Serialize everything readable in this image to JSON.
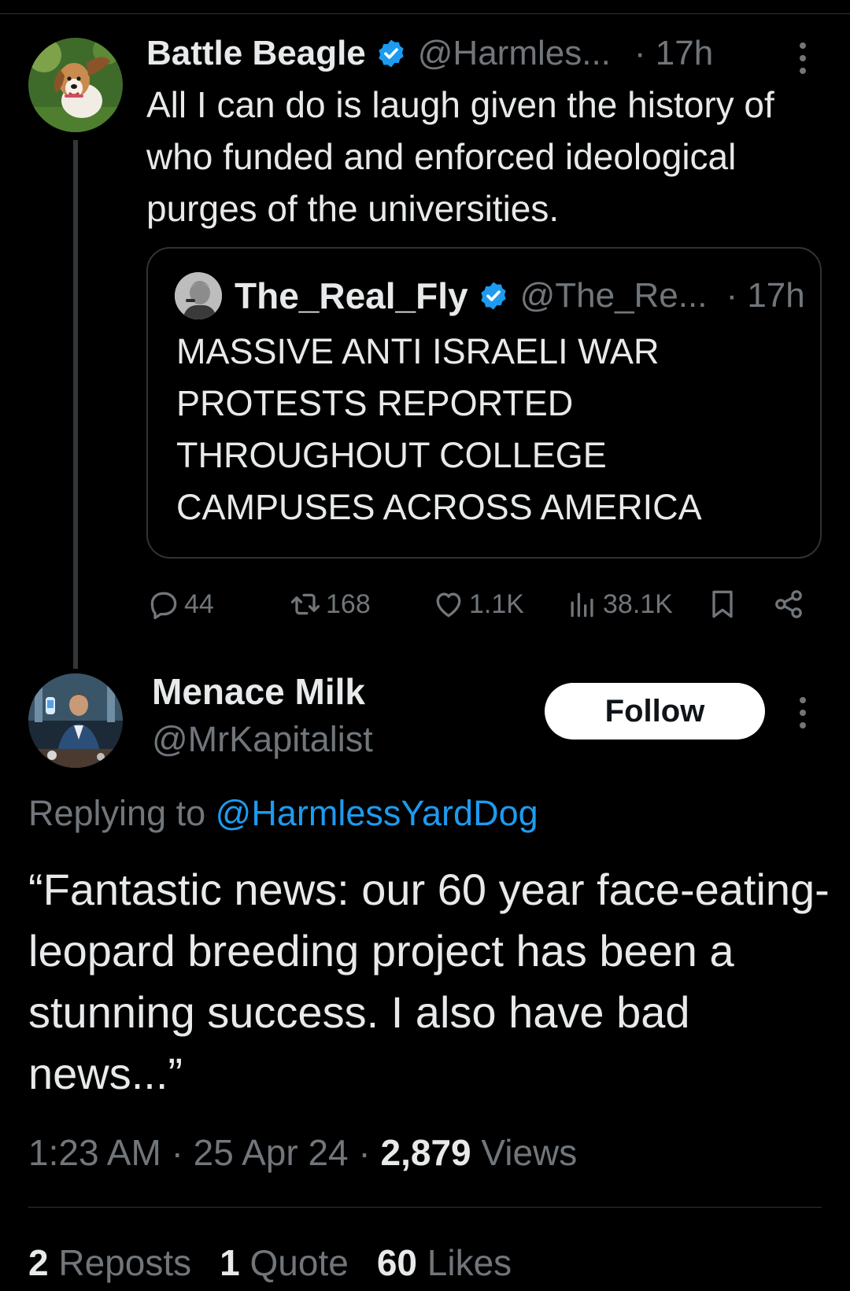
{
  "parent_tweet": {
    "display_name": "Battle Beagle",
    "handle": "@Harmles...",
    "time": "· 17h",
    "text": "All I can do is laugh given the history of who funded and enforced ideological purges of the universities.",
    "avatar_icon": "beagle-avatar",
    "verified_icon": "verified-badge-icon"
  },
  "quoted_tweet": {
    "display_name": "The_Real_Fly",
    "handle": "@The_Re...",
    "time": "· 17h",
    "text": "MASSIVE ANTI ISRAELI WAR PROTESTS REPORTED THROUGHOUT COLLEGE CAMPUSES ACROSS AMERICA",
    "avatar_icon": "portrait-avatar"
  },
  "actions": {
    "replies": "44",
    "reposts": "168",
    "likes": "1.1K",
    "views": "38.1K"
  },
  "main_tweet": {
    "display_name": "Menace Milk",
    "handle": "@MrKapitalist",
    "follow_label": "Follow",
    "replying_prefix": "Replying to",
    "replying_mention": "@HarmlessYardDog",
    "text": "“Fantastic news: our 60 year face-eating-leopard breeding project has been a stunning success. I also have bad news...”",
    "time": "1:23 AM",
    "date": "25 Apr 24",
    "views_count": "2,879",
    "views_label": "Views"
  },
  "stats": {
    "reposts_count": "2",
    "reposts_label": "Reposts",
    "quotes_count": "1",
    "quotes_label": "Quote",
    "likes_count": "60",
    "likes_label": "Likes"
  },
  "colors": {
    "background": "#000000",
    "text_primary": "#e7e9ea",
    "text_secondary": "#71767b",
    "accent_blue": "#1d9bf0",
    "divider": "#2f3336"
  }
}
